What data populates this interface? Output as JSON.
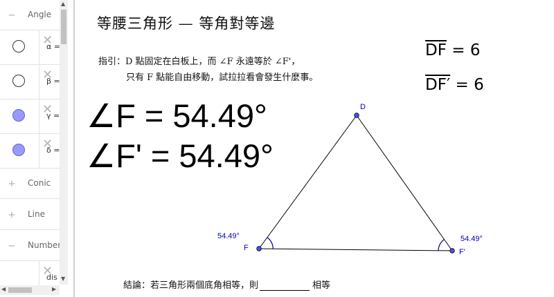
{
  "algebra": {
    "categories": {
      "angle": {
        "label": "Angle",
        "toggle": "−"
      },
      "conic": {
        "label": "Conic",
        "toggle": "+"
      },
      "line": {
        "label": "Line",
        "toggle": "+"
      },
      "number": {
        "label": "Number",
        "toggle": "−"
      }
    },
    "objects": [
      {
        "value": "α =",
        "visible": false
      },
      {
        "value": "β =",
        "visible": false
      },
      {
        "value": "γ =",
        "visible": true
      },
      {
        "value": "δ =",
        "visible": true
      },
      {
        "value": "dis",
        "visible": null
      }
    ]
  },
  "graphics": {
    "title": "等腰三角形 — 等角對等邊",
    "guide_line1": "指引：D 點固定在白板上，而 ∠F 永遠等於 ∠F'，",
    "guide_line2": "只有 F 點能自由移動，試拉拉看會發生什麼事。",
    "angle_F_text": "∠F = 54.49°",
    "angle_F2_text": "∠F' = 54.49°",
    "segment_DF": {
      "name": "DF",
      "eq": "=",
      "value": "6"
    },
    "segment_DF2": {
      "name": "DF′",
      "eq": "=",
      "value": "6"
    },
    "conclusion_prefix": "結論：若三角形兩個底角相等，則",
    "conclusion_suffix": "相等",
    "points": {
      "D": "D",
      "F": "F",
      "F2": "F'"
    },
    "angle_labels": {
      "F": "54.49°",
      "F2": "54.49°"
    }
  },
  "colors": {
    "point": "#4d4dff",
    "point_label": "#0000b4",
    "angle_arc": "#000080",
    "visible_toggle": "#9999ff"
  }
}
